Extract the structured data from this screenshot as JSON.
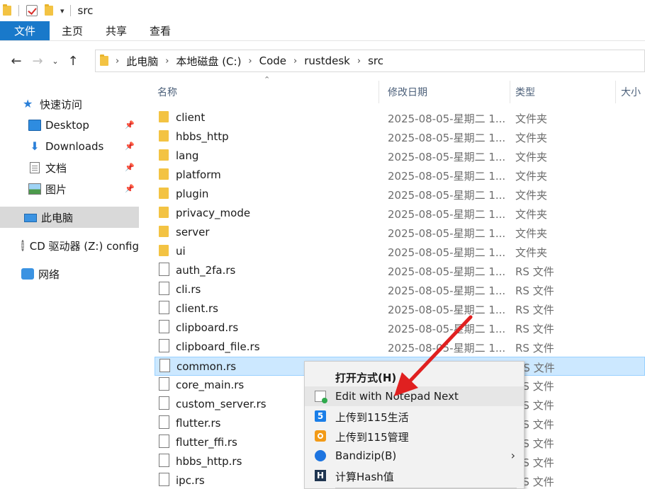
{
  "window": {
    "title": "src"
  },
  "ribbon": {
    "tabs": [
      "文件",
      "主页",
      "共享",
      "查看"
    ]
  },
  "address": {
    "crumbs": [
      "此电脑",
      "本地磁盘 (C:)",
      "Code",
      "rustdesk",
      "src"
    ]
  },
  "navpane": {
    "quick_access": "快速访问",
    "desktop": "Desktop",
    "downloads": "Downloads",
    "documents": "文档",
    "pictures": "图片",
    "this_pc": "此电脑",
    "cd_drive": "CD 驱动器 (Z:) config",
    "network": "网络"
  },
  "columns": {
    "name": "名称",
    "date": "修改日期",
    "type": "类型",
    "size": "大小"
  },
  "files": [
    {
      "name": "client",
      "date": "2025-08-05-星期二 1...",
      "type": "文件夹",
      "kind": "folder"
    },
    {
      "name": "hbbs_http",
      "date": "2025-08-05-星期二 1...",
      "type": "文件夹",
      "kind": "folder"
    },
    {
      "name": "lang",
      "date": "2025-08-05-星期二 1...",
      "type": "文件夹",
      "kind": "folder"
    },
    {
      "name": "platform",
      "date": "2025-08-05-星期二 1...",
      "type": "文件夹",
      "kind": "folder"
    },
    {
      "name": "plugin",
      "date": "2025-08-05-星期二 1...",
      "type": "文件夹",
      "kind": "folder"
    },
    {
      "name": "privacy_mode",
      "date": "2025-08-05-星期二 1...",
      "type": "文件夹",
      "kind": "folder"
    },
    {
      "name": "server",
      "date": "2025-08-05-星期二 1...",
      "type": "文件夹",
      "kind": "folder"
    },
    {
      "name": "ui",
      "date": "2025-08-05-星期二 1...",
      "type": "文件夹",
      "kind": "folder"
    },
    {
      "name": "auth_2fa.rs",
      "date": "2025-08-05-星期二 1...",
      "type": "RS 文件",
      "kind": "file"
    },
    {
      "name": "cli.rs",
      "date": "2025-08-05-星期二 1...",
      "type": "RS 文件",
      "kind": "file"
    },
    {
      "name": "client.rs",
      "date": "2025-08-05-星期二 1...",
      "type": "RS 文件",
      "kind": "file"
    },
    {
      "name": "clipboard.rs",
      "date": "2025-08-05-星期二 1...",
      "type": "RS 文件",
      "kind": "file"
    },
    {
      "name": "clipboard_file.rs",
      "date": "2025-08-05-星期二 1...",
      "type": "RS 文件",
      "kind": "file"
    },
    {
      "name": "common.rs",
      "date": "",
      "type": "RS 文件",
      "kind": "file",
      "selected": true
    },
    {
      "name": "core_main.rs",
      "date": "",
      "type": "RS 文件",
      "kind": "file"
    },
    {
      "name": "custom_server.rs",
      "date": "",
      "type": "RS 文件",
      "kind": "file"
    },
    {
      "name": "flutter.rs",
      "date": "",
      "type": "RS 文件",
      "kind": "file"
    },
    {
      "name": "flutter_ffi.rs",
      "date": "",
      "type": "RS 文件",
      "kind": "file"
    },
    {
      "name": "hbbs_http.rs",
      "date": "",
      "type": "RS 文件",
      "kind": "file"
    },
    {
      "name": "ipc.rs",
      "date": "",
      "type": "RS 文件",
      "kind": "file"
    }
  ],
  "context_menu": {
    "open_with": "打开方式(H)",
    "notepad_next": "Edit with Notepad Next",
    "upload_115_life": "上传到115生活",
    "upload_115_manage": "上传到115管理",
    "bandizip": "Bandizip(B)",
    "hash": "计算Hash值"
  },
  "colors": {
    "accent": "#1979ca",
    "selection": "#cce8ff",
    "annotation_arrow": "#e02020"
  }
}
